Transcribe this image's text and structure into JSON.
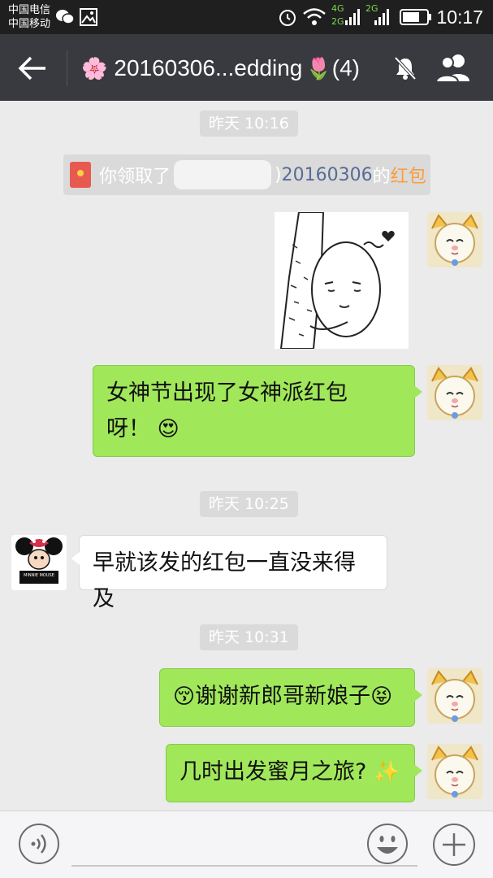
{
  "status_bar": {
    "carrier1": "中国电信",
    "carrier2": "中国移动",
    "net_4g": "4G",
    "net_2g_left": "2G",
    "net_2g_right": "2G",
    "time": "10:17"
  },
  "title_bar": {
    "prefix_emoji": "🌸",
    "title": "20160306...edding",
    "suffix_emoji": "🌷",
    "member_count": "(4)",
    "icons": [
      "back-arrow-icon",
      "mute-bell-icon",
      "group-members-icon"
    ]
  },
  "timestamps": [
    "昨天 10:16",
    "昨天 10:25",
    "昨天 10:31"
  ],
  "system_message": {
    "prefix": "你领取了",
    "suffix_close": ")",
    "group": "20160306",
    "of": "的",
    "red_packet": "红包"
  },
  "messages": [
    {
      "side": "right",
      "type": "sticker",
      "text": "~"
    },
    {
      "side": "right",
      "type": "text",
      "line1": "女神节出现了女神派红包",
      "line2": "呀！",
      "emoji": "😍"
    },
    {
      "side": "left",
      "type": "text",
      "text": "早就该发的红包一直没来得及",
      "avatar_caption": "MINNIE MOUSE"
    },
    {
      "side": "right",
      "type": "text",
      "emoji_pre": "😚",
      "text": "谢谢新郎哥新娘子",
      "emoji_post": "😝"
    },
    {
      "side": "right",
      "type": "text",
      "text": "几时出发蜜月之旅?",
      "emoji_post": "✨"
    }
  ],
  "input_bar": {
    "placeholder": "",
    "icons": [
      "voice-icon",
      "emoji-icon",
      "plus-icon"
    ]
  },
  "colors": {
    "status_bar": "#1f1f1f",
    "title_bar": "#393a3f",
    "chat_bg": "#ebebeb",
    "bubble_green": "#a0e75a",
    "link_blue": "#576b95",
    "red_packet_orange": "#fa9d3b"
  }
}
